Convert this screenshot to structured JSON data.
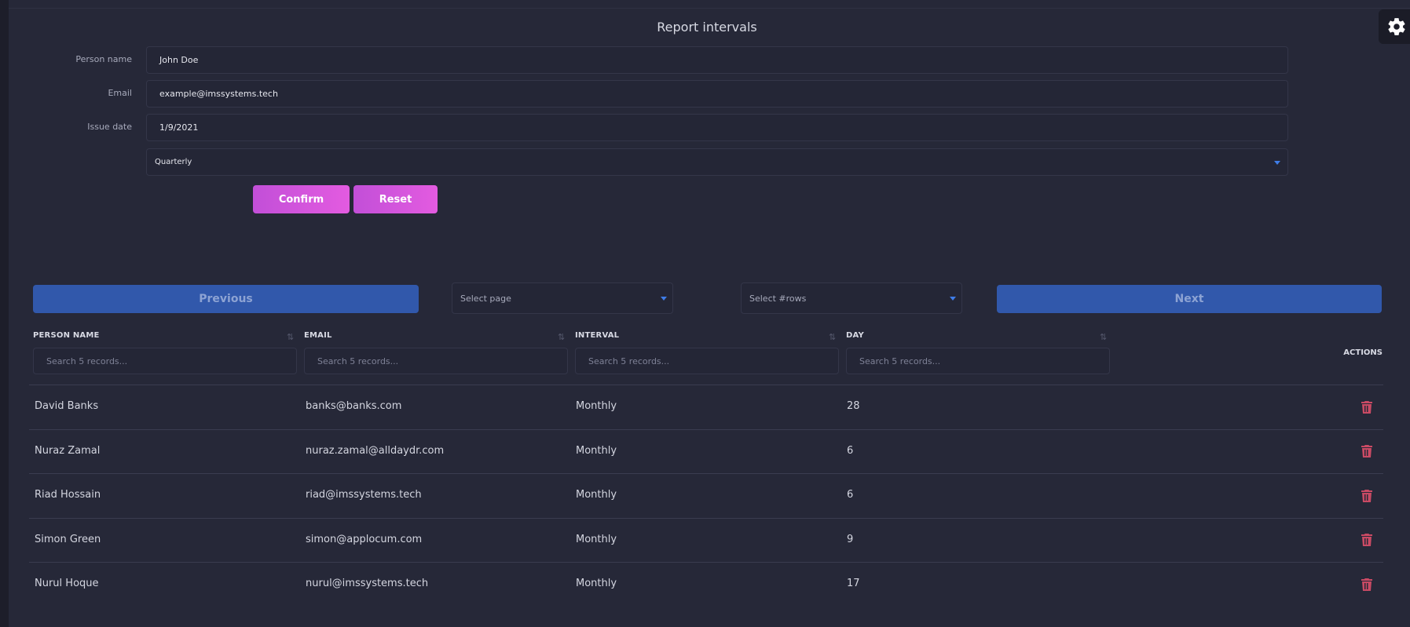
{
  "page": {
    "title": "Report intervals"
  },
  "settings": {
    "icon": "gear-icon"
  },
  "form": {
    "person_name": {
      "label": "Person name",
      "value": "John Doe"
    },
    "email": {
      "label": "Email",
      "value": "example@imssystems.tech"
    },
    "issue_date": {
      "label": "Issue date",
      "value": "1/9/2021"
    },
    "interval": {
      "selected": "Quarterly"
    },
    "confirm_label": "Confirm",
    "reset_label": "Reset"
  },
  "pagination": {
    "previous_label": "Previous",
    "next_label": "Next",
    "page_select_placeholder": "Select page",
    "rows_select_placeholder": "Select #rows"
  },
  "table": {
    "columns": [
      "PERSON NAME",
      "EMAIL",
      "INTERVAL",
      "DAY"
    ],
    "search_placeholder": "Search 5 records...",
    "actions_label": "ACTIONS",
    "rows": [
      [
        "David Banks",
        "banks@banks.com",
        "Monthly",
        "28"
      ],
      [
        "Nuraz Zamal",
        "nuraz.zamal@alldaydr.com",
        "Monthly",
        "6"
      ],
      [
        "Riad Hossain",
        "riad@imssystems.tech",
        "Monthly",
        "6"
      ],
      [
        "Simon Green",
        "simon@applocum.com",
        "Monthly",
        "9"
      ],
      [
        "Nurul Hoque",
        "nurul@imssystems.tech",
        "Monthly",
        "17"
      ]
    ]
  },
  "colors": {
    "background": "#262838",
    "accent_gradient_start": "#c24fd8",
    "accent_gradient_end": "#e35be0",
    "nav_button": "#3158ab",
    "delete_icon": "#c94a64"
  }
}
